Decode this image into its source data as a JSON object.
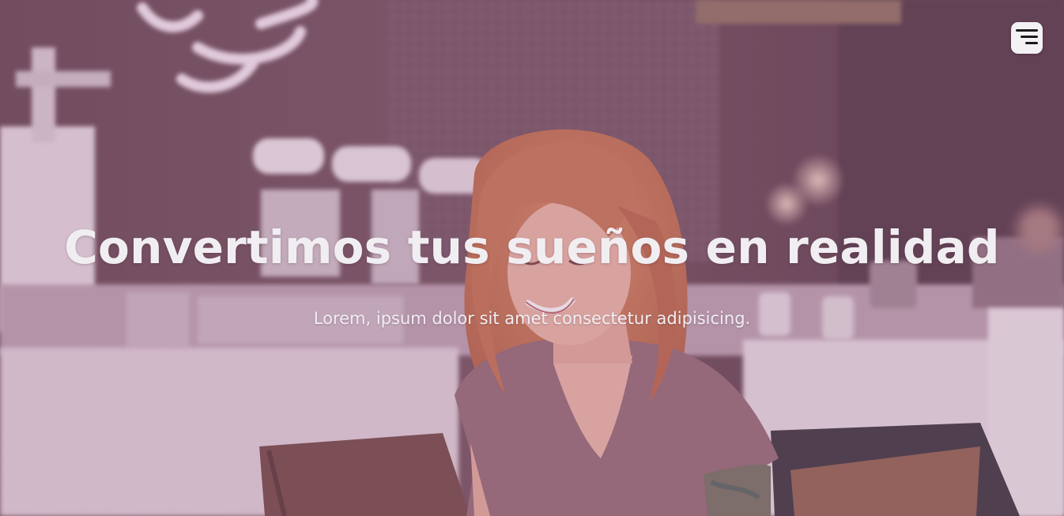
{
  "hero": {
    "headline": "Convertimos tus sueños en realidad",
    "subtitle": "Lorem, ipsum dolor sit amet consectetur adipisicing.",
    "background_image": "woman-smiling-in-cafe-photo"
  },
  "nav": {
    "menu_icon": "hamburger-menu-icon"
  },
  "colors": {
    "overlay_tint": "#aa7896",
    "text": "#f1eef2",
    "menu_button_bg": "#f3f1f3",
    "menu_icon": "#1a1a1a"
  }
}
